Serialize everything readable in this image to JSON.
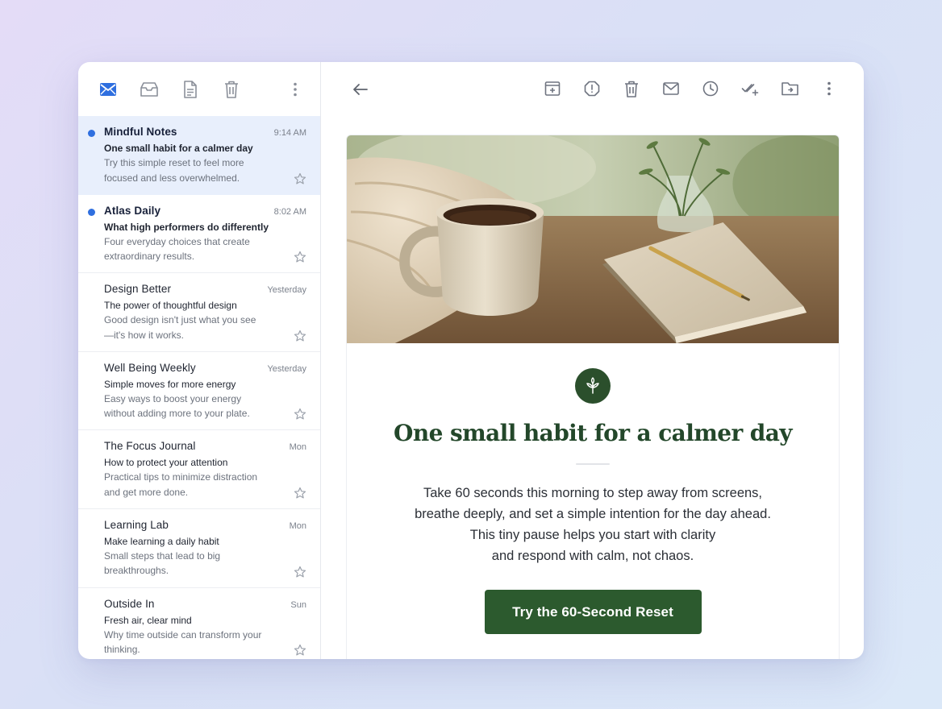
{
  "sidebar": {
    "toolbar": {
      "icons": [
        "mail-icon",
        "archive-icon",
        "document-icon",
        "trash-icon",
        "more-vertical-icon"
      ],
      "accent": "#2f6fdf"
    },
    "messages": [
      {
        "sender": "Mindful Notes",
        "time": "9:14 AM",
        "subject": "One small habit for a calmer day",
        "preview": "Try this simple reset to feel more focused and less overwhelmed.",
        "unread": true,
        "selected": true
      },
      {
        "sender": "Atlas Daily",
        "time": "8:02 AM",
        "subject": "What high performers do differently",
        "preview": "Four everyday choices that create extraordinary results.",
        "unread": true,
        "selected": false
      },
      {
        "sender": "Design Better",
        "time": "Yesterday",
        "subject": "The power of thoughtful design",
        "preview": "Good design isn't just what you see—it's how it works.",
        "unread": false,
        "selected": false
      },
      {
        "sender": "Well Being Weekly",
        "time": "Yesterday",
        "subject": "Simple moves for more energy",
        "preview": "Easy ways to boost your energy without adding more to your plate.",
        "unread": false,
        "selected": false
      },
      {
        "sender": "The Focus Journal",
        "time": "Mon",
        "subject": "How to protect your attention",
        "preview": "Practical tips to minimize distraction and get more done.",
        "unread": false,
        "selected": false
      },
      {
        "sender": "Learning Lab",
        "time": "Mon",
        "subject": "Make learning a daily habit",
        "preview": "Small steps that lead to big breakthroughs.",
        "unread": false,
        "selected": false
      },
      {
        "sender": "Outside In",
        "time": "Sun",
        "subject": "Fresh air, clear mind",
        "preview": "Why time outside can transform your thinking.",
        "unread": false,
        "selected": false
      }
    ]
  },
  "main": {
    "toolbar": {
      "back_icon": "arrow-left-icon",
      "actions": [
        "archive-add-icon",
        "report-spam-icon",
        "delete-icon",
        "mark-unread-icon",
        "snooze-icon",
        "add-task-icon",
        "move-to-folder-icon",
        "more-vertical-icon"
      ]
    },
    "email": {
      "hero_image": "coffee-mug-notebook-pencil-photo",
      "badge_icon": "leaf-icon",
      "title": "One small habit for a calmer day",
      "body_lines": [
        "Take 60 seconds this morning to step away from screens,",
        "breathe deeply, and set a simple intention for the day ahead.",
        "This tiny pause helps you start with clarity",
        "and respond with calm, not chaos."
      ],
      "cta_label": "Try the 60-Second Reset",
      "brand_color": "#2c5a2e"
    }
  }
}
